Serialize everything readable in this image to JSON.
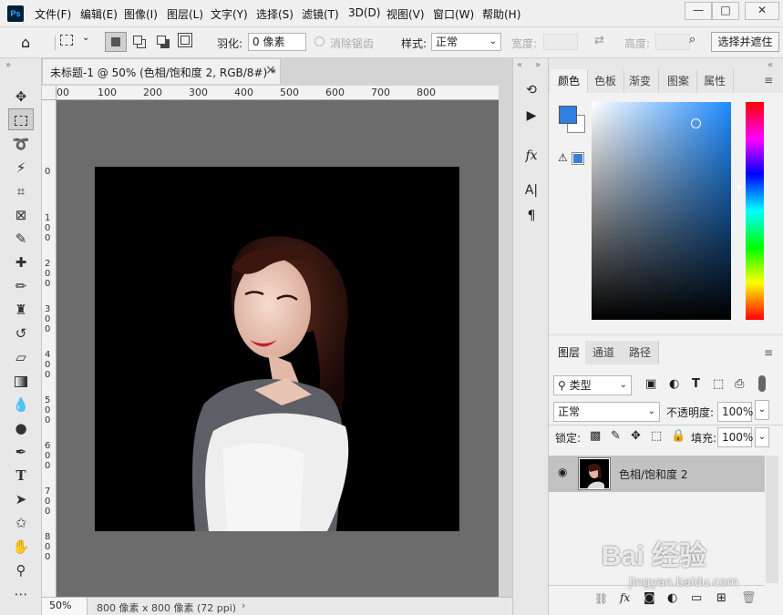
{
  "app": {
    "logo": "Ps"
  },
  "menu": [
    "文件(F)",
    "编辑(E)",
    "图像(I)",
    "图层(L)",
    "文字(Y)",
    "选择(S)",
    "滤镜(T)",
    "3D(D)",
    "视图(V)",
    "窗口(W)",
    "帮助(H)"
  ],
  "window_controls": {
    "minimize": "—",
    "restore": "□",
    "close": "✕"
  },
  "options": {
    "feather_label": "羽化:",
    "feather_value": "0 像素",
    "antialias_label": "消除锯齿",
    "style_label": "样式:",
    "style_value": "正常",
    "width_label": "宽度:",
    "height_label": "高度:",
    "select_mask_button": "选择并遮住"
  },
  "document": {
    "tab_title": "未标题-1 @ 50% (色相/饱和度 2, RGB/8#) *",
    "close_glyph": "×",
    "zoom": "50%",
    "doc_info": "800 像素 x 800 像素 (72 ppi)",
    "ruler_h": [
      "00",
      "100",
      "200",
      "300",
      "400",
      "500",
      "600",
      "700",
      "800"
    ],
    "ruler_v": [
      "0",
      "1 0 0",
      "2 0 0",
      "3 0 0",
      "4 0 0",
      "5 0 0",
      "6 0 0",
      "7 0 0",
      "8 0 0"
    ]
  },
  "tools": [
    "move",
    "marquee",
    "lasso",
    "magic-wand",
    "crop",
    "frame",
    "eyedropper",
    "healing",
    "brush",
    "stamp",
    "history-brush",
    "eraser",
    "gradient",
    "blur",
    "dodge",
    "pen",
    "type",
    "path-select",
    "shape",
    "hand",
    "zoom",
    "more"
  ],
  "color_panel": {
    "tabs": [
      "颜色",
      "色板",
      "渐变",
      "图案",
      "属性"
    ],
    "foreground": "#2f7fe0",
    "background": "#ffffff",
    "websafe_swatch": "#3a7fd5"
  },
  "layers_panel": {
    "tabs": [
      "图层",
      "通道",
      "路径"
    ],
    "filter_kind": "类型",
    "blend_mode": "正常",
    "opacity_label": "不透明度:",
    "opacity_value": "100%",
    "lock_label": "锁定:",
    "fill_label": "填充:",
    "fill_value": "100%",
    "layers": [
      {
        "name": "色相/饱和度 2",
        "visible": true
      }
    ]
  },
  "watermark": {
    "text": "Bai 经验",
    "url": "jingyan.baidu.com"
  }
}
